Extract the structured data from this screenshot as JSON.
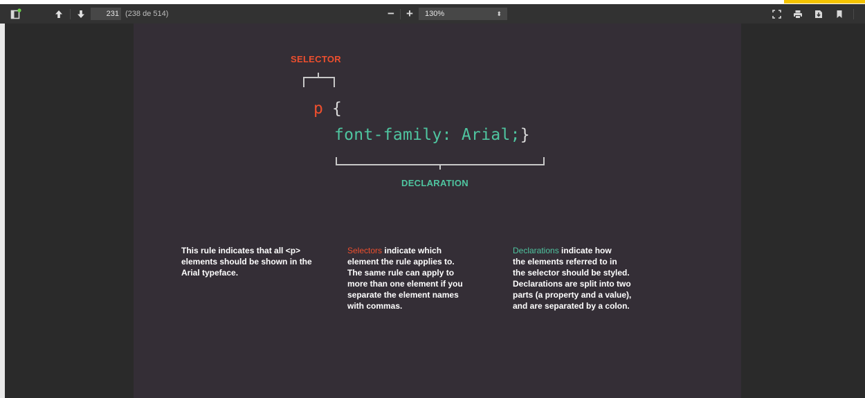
{
  "toolbar": {
    "page_number": "231",
    "page_count": "(238 de 514)",
    "zoom_minus": "−",
    "zoom_plus": "+",
    "zoom_value": "130%",
    "zoom_caret": "⬍"
  },
  "colors": {
    "accent": "#f5c400",
    "selector_red": "#ee4f2e",
    "declaration_green": "#4fc5a0",
    "page_bg": "#342e36"
  },
  "icons": [
    "sidebar-toggle-icon",
    "arrow-up-icon",
    "arrow-down-icon",
    "fullscreen-icon",
    "print-icon",
    "download-icon",
    "bookmark-icon"
  ],
  "document": {
    "selector_label": "SELECTOR",
    "code_selector": "p",
    "code_open_brace": "{",
    "code_declaration": "font-family: Arial;",
    "code_close_brace": "}",
    "declaration_label": "DECLARATION",
    "col1": {
      "lines": [
        "This rule indicates that all <p>",
        "elements should be shown in the",
        "Arial typeface."
      ]
    },
    "col2": {
      "keyword": "Selectors",
      "first_rest": " indicate which",
      "lines": [
        "element the rule applies to.",
        "The same rule can apply to",
        "more than one element if you",
        "separate the element names",
        "with commas."
      ]
    },
    "col3": {
      "keyword": "Declarations",
      "first_rest": " indicate how",
      "lines": [
        "the elements referred to in",
        "the selector should be styled.",
        "Declarations are split into two",
        "parts (a property and a value),",
        "and are separated by a colon."
      ]
    }
  }
}
